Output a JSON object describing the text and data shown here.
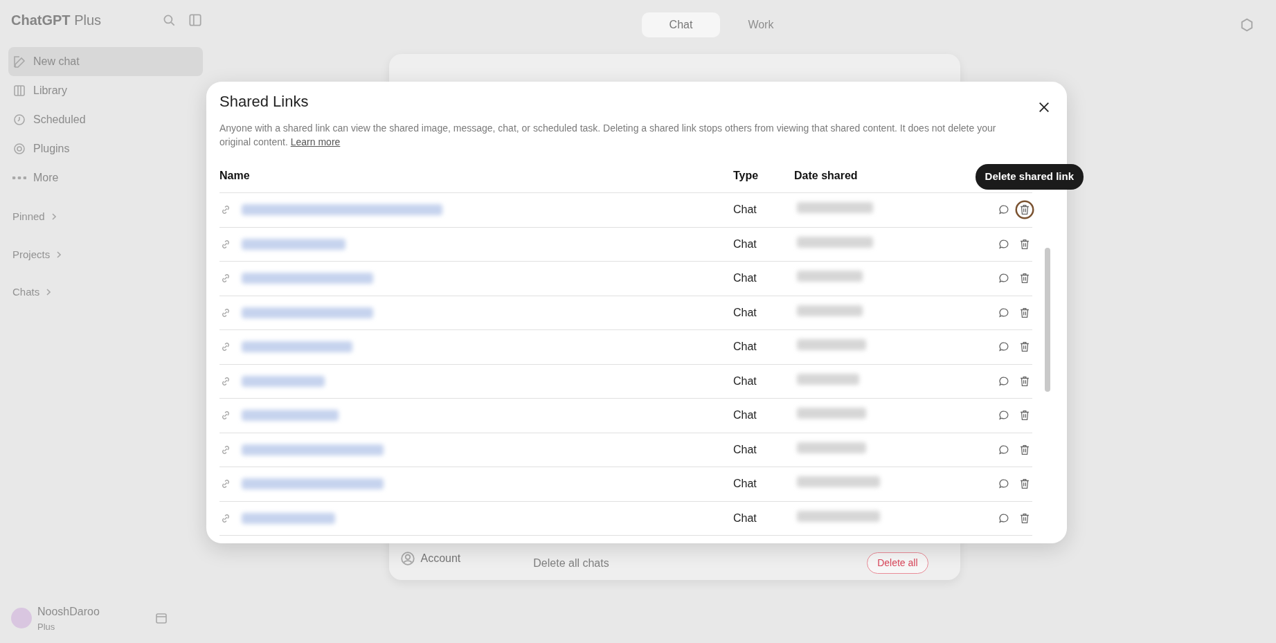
{
  "sidebar": {
    "brand": "ChatGPT",
    "plan": "Plus",
    "items": [
      {
        "label": "New chat",
        "kind": "edit",
        "selected": true
      },
      {
        "label": "Library",
        "kind": "library",
        "selected": false
      },
      {
        "label": "Scheduled",
        "kind": "clock",
        "selected": false
      },
      {
        "label": "Plugins",
        "kind": "plugin",
        "selected": false
      },
      {
        "label": "More",
        "kind": "dots",
        "selected": false
      }
    ],
    "sections": [
      "Pinned",
      "Projects",
      "Chats"
    ],
    "user": {
      "name": "NooshDaroo",
      "plan": "Plus"
    }
  },
  "mode_tabs": [
    {
      "label": "Chat",
      "selected": true
    },
    {
      "label": "Work",
      "selected": false
    }
  ],
  "settings": {
    "nav_item": "Account",
    "row_label": "Delete all chats",
    "button": "Delete all"
  },
  "dialog": {
    "title": "Shared Links",
    "description": "Anyone with a shared link can view the shared image, message, chat, or scheduled task. Deleting a shared link stops others from viewing that shared content. It does not delete your original content.",
    "learn_more": "Learn more",
    "columns": [
      "Name",
      "Type",
      "Date shared"
    ],
    "tooltip": "Delete shared link",
    "rows": [
      {
        "type": "Chat",
        "focused": true
      },
      {
        "type": "Chat",
        "focused": false
      },
      {
        "type": "Chat",
        "focused": false
      },
      {
        "type": "Chat",
        "focused": false
      },
      {
        "type": "Chat",
        "focused": false
      },
      {
        "type": "Chat",
        "focused": false
      },
      {
        "type": "Chat",
        "focused": false
      },
      {
        "type": "Chat",
        "focused": false
      },
      {
        "type": "Chat",
        "focused": false
      },
      {
        "type": "Chat",
        "focused": false
      }
    ]
  }
}
